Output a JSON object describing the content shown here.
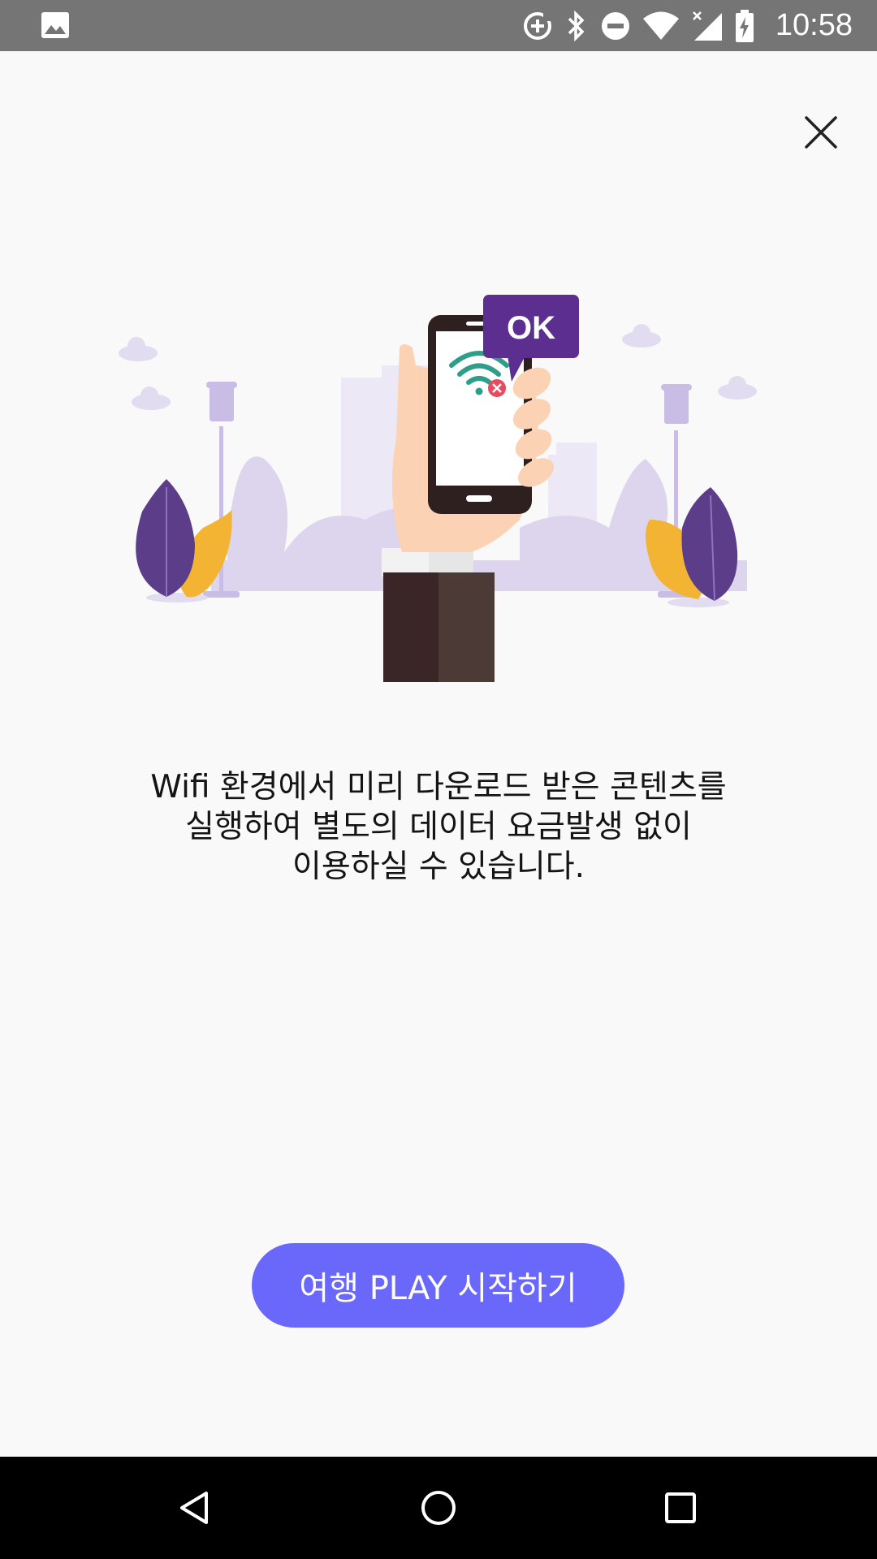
{
  "status_bar": {
    "time": "10:58",
    "icons": [
      "image-icon",
      "data-saver-icon",
      "bluetooth-icon",
      "do-not-disturb-icon",
      "wifi-icon",
      "cellular-no-signal-icon",
      "battery-charging-icon"
    ]
  },
  "dialog": {
    "close_icon": "close-icon",
    "illustration": {
      "bubble_text": "OK"
    },
    "message_lines": [
      "Wifi 환경에서 미리 다운로드 받은 콘텐츠를",
      "실행하여 별도의 데이터 요금발생 없이",
      "이용하실 수 있습니다."
    ],
    "cta_label": "여행 PLAY 시작하기"
  },
  "nav_bar": {
    "icons": [
      "back-icon",
      "home-icon",
      "recents-icon"
    ]
  },
  "colors": {
    "accent": "#6a68fa",
    "bubble": "#5b2e8f",
    "status_bar": "#757575",
    "background": "#f9f9f9"
  }
}
